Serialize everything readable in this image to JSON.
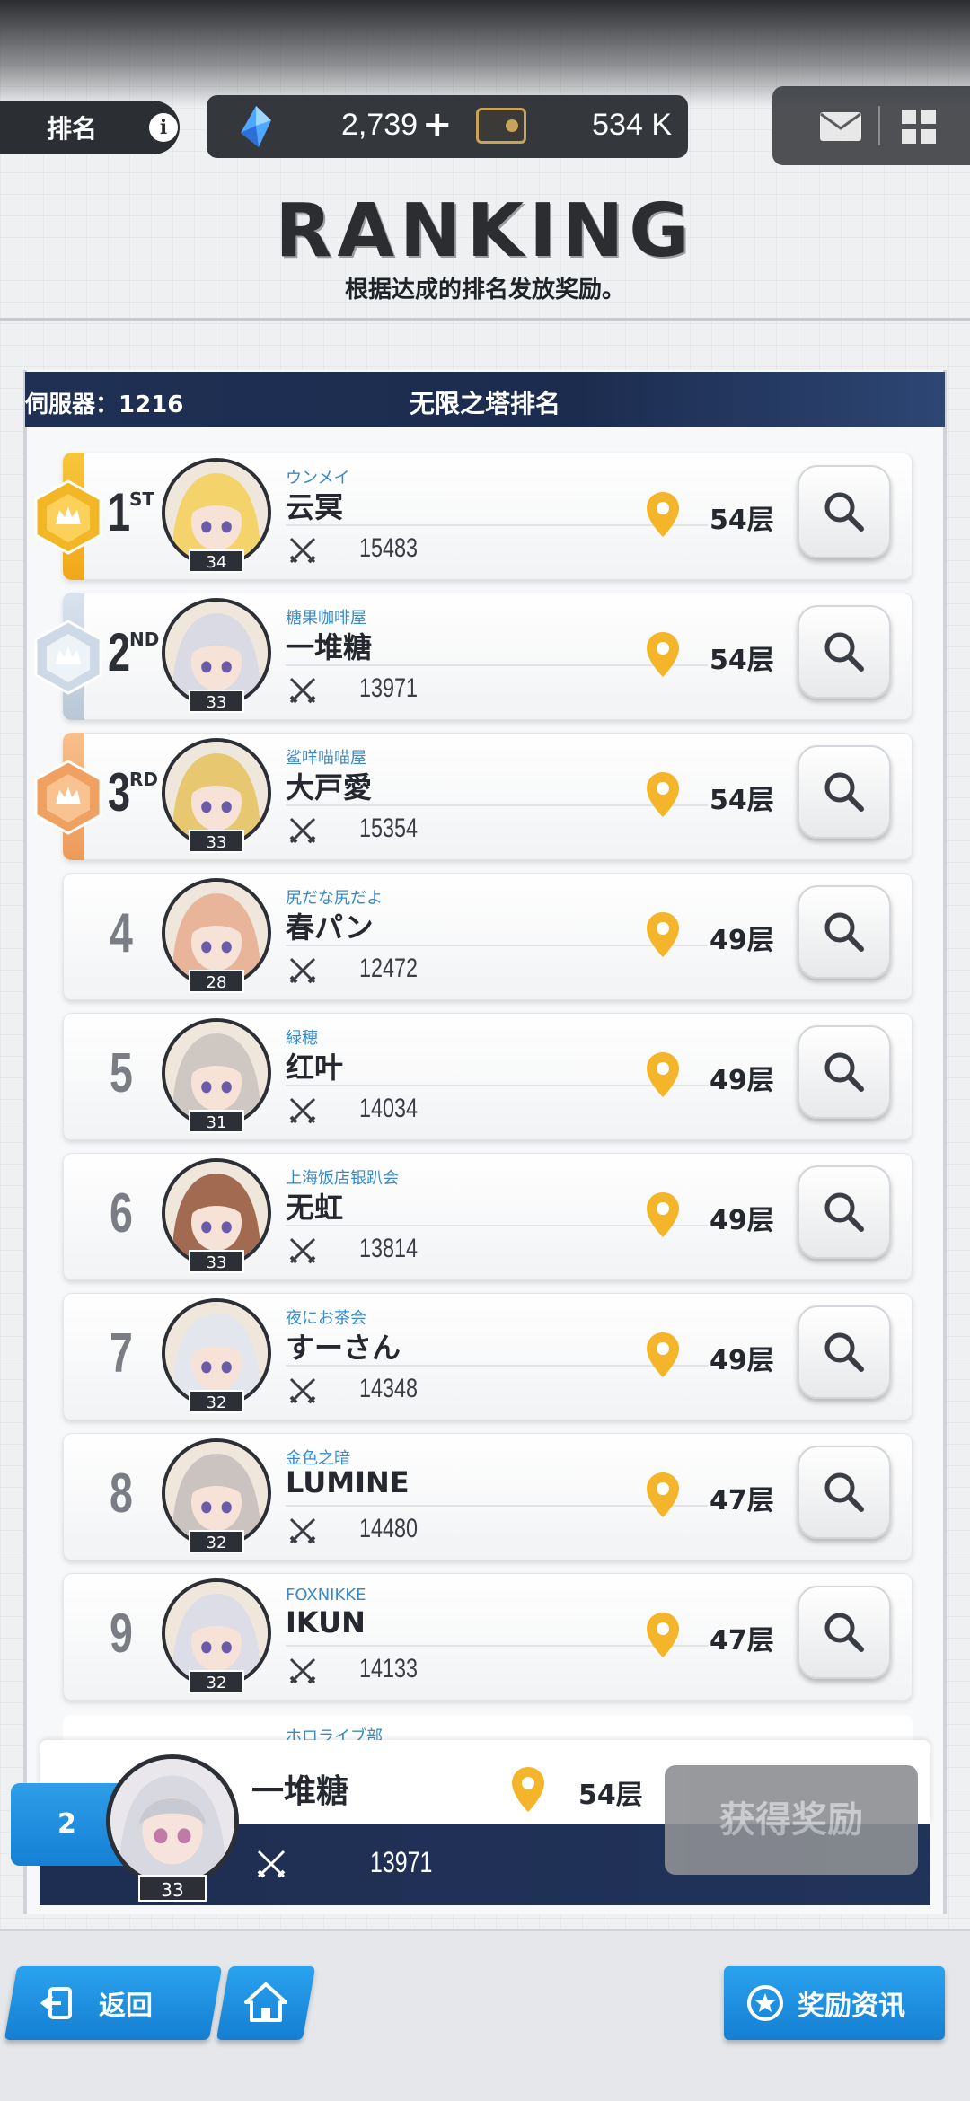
{
  "header": {
    "tab_label": "排名",
    "gems": "2,739",
    "credits": "534 K",
    "title": "RANKING",
    "subtitle": "根据达成的排名发放奖励。"
  },
  "panel": {
    "server": "伺服器：1216",
    "title": "无限之塔排名"
  },
  "rows": [
    {
      "rank": "1",
      "suffix": "ST",
      "guild": "ウンメイ",
      "name": "云冥",
      "level": "34",
      "power": "15483",
      "floor": "54层",
      "tier": "gold"
    },
    {
      "rank": "2",
      "suffix": "ND",
      "guild": "糖果咖啡屋",
      "name": "一堆糖",
      "level": "33",
      "power": "13971",
      "floor": "54层",
      "tier": "silver"
    },
    {
      "rank": "3",
      "suffix": "RD",
      "guild": "鲨咩喵喵屋",
      "name": "大戸愛",
      "level": "33",
      "power": "15354",
      "floor": "54层",
      "tier": "bronze"
    },
    {
      "rank": "4",
      "suffix": "",
      "guild": "尻だな尻だよ",
      "name": "春パン",
      "level": "28",
      "power": "12472",
      "floor": "49层",
      "tier": ""
    },
    {
      "rank": "5",
      "suffix": "",
      "guild": "緑穂",
      "name": "红叶",
      "level": "31",
      "power": "14034",
      "floor": "49层",
      "tier": ""
    },
    {
      "rank": "6",
      "suffix": "",
      "guild": "上海饭店银趴会",
      "name": "无虹",
      "level": "33",
      "power": "13814",
      "floor": "49层",
      "tier": ""
    },
    {
      "rank": "7",
      "suffix": "",
      "guild": "夜にお茶会",
      "name": "すーさん",
      "level": "32",
      "power": "14348",
      "floor": "49层",
      "tier": ""
    },
    {
      "rank": "8",
      "suffix": "",
      "guild": "金色之暗",
      "name": "LUMINE",
      "level": "32",
      "power": "14480",
      "floor": "47层",
      "tier": ""
    },
    {
      "rank": "9",
      "suffix": "",
      "guild": "FOXNIKKE",
      "name": "IKUN",
      "level": "32",
      "power": "14133",
      "floor": "47层",
      "tier": ""
    }
  ],
  "partial_row": {
    "guild": "ホロライブ部"
  },
  "my_rank": {
    "rank": "2",
    "name": "一堆糖",
    "level": "33",
    "power": "13971",
    "floor": "54层",
    "reward_button": "获得奖励"
  },
  "nav": {
    "back": "返回",
    "rewards_info": "奖励资讯"
  },
  "colors": {
    "accent_blue": "#1e8fe0",
    "navy": "#1f3054",
    "gold": "#f4b52a",
    "pin": "#f4b52a",
    "guild_text": "#3a8ac7"
  },
  "icons": [
    "info-icon",
    "gem-icon",
    "plus-icon",
    "credit-card-icon",
    "mail-icon",
    "menu-grid-icon",
    "crossed-swords-icon",
    "location-pin-icon",
    "search-icon",
    "back-arrow-icon",
    "home-icon",
    "medal-icon"
  ]
}
